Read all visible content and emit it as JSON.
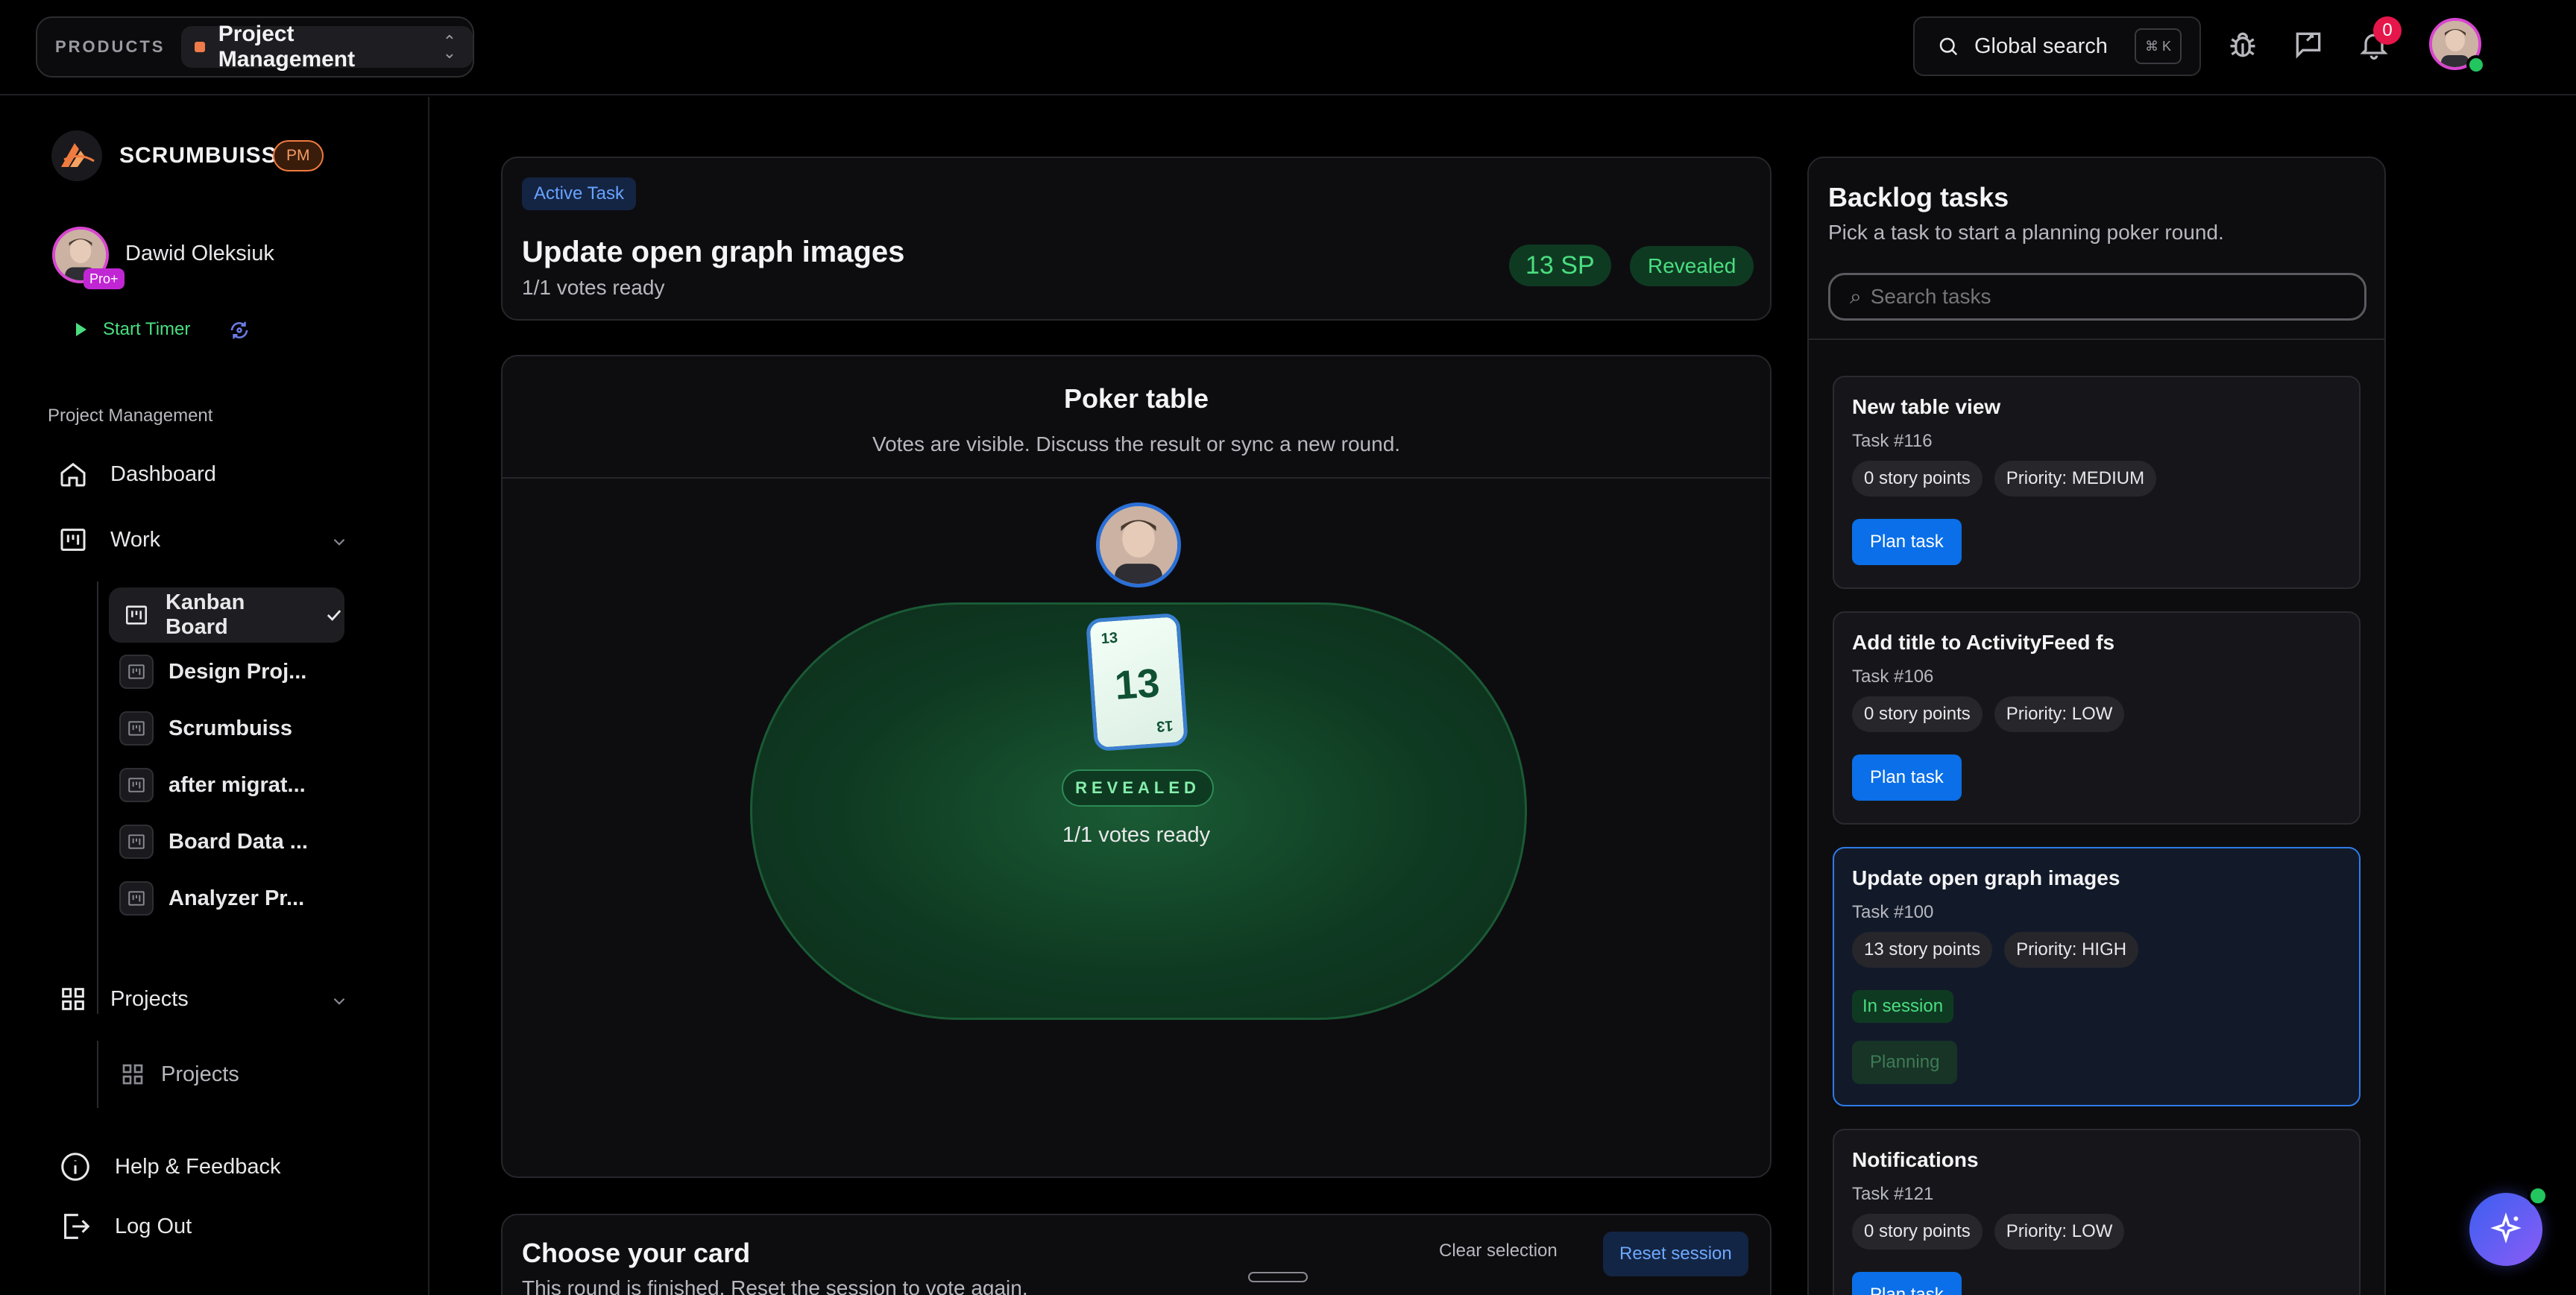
{
  "topbar": {
    "products_label": "PRODUCTS",
    "product_name": "Project Management",
    "search_label": "Global search",
    "search_kbd": "⌘ K",
    "notification_count": "0"
  },
  "sidebar": {
    "brand": "SCRUMBUISS",
    "brand_badge": "PM",
    "user_name": "Dawid Oleksiuk",
    "user_badge": "Pro+",
    "start_timer": "Start Timer",
    "section_label": "Project Management",
    "dashboard": "Dashboard",
    "work": "Work",
    "work_items": [
      {
        "label": "Kanban Board"
      },
      {
        "label": "Design Proj..."
      },
      {
        "label": "Scrumbuiss"
      },
      {
        "label": "after migrat..."
      },
      {
        "label": "Board Data ..."
      },
      {
        "label": "Analyzer Pr..."
      }
    ],
    "projects": "Projects",
    "projects_items": [
      {
        "label": "Projects"
      }
    ],
    "help": "Help & Feedback",
    "logout": "Log Out"
  },
  "active_task": {
    "chip": "Active Task",
    "title": "Update open graph images",
    "votes": "1/1 votes ready",
    "sp": "13 SP",
    "status": "Revealed"
  },
  "poker": {
    "title": "Poker table",
    "subtitle": "Votes are visible. Discuss the result or sync a new round.",
    "card_value": "13",
    "revealed_label": "REVEALED",
    "votes_ready": "1/1 votes ready"
  },
  "choose": {
    "title": "Choose your card",
    "subtitle": "This round is finished. Reset the session to vote again.",
    "clear": "Clear selection",
    "reset": "Reset session"
  },
  "backlog": {
    "title": "Backlog tasks",
    "subtitle": "Pick a task to start a planning poker round.",
    "search_placeholder": "Search tasks",
    "tasks": [
      {
        "title": "New table view",
        "id": "Task #116",
        "points": "0 story points",
        "priority": "Priority: MEDIUM",
        "action": "Plan task"
      },
      {
        "title": "Add title to ActivityFeed fs",
        "id": "Task #106",
        "points": "0 story points",
        "priority": "Priority: LOW",
        "action": "Plan task"
      },
      {
        "title": "Update open graph images",
        "id": "Task #100",
        "points": "13 story points",
        "priority": "Priority: HIGH",
        "status": "In session",
        "action": "Planning"
      },
      {
        "title": "Notifications",
        "id": "Task #121",
        "points": "0 story points",
        "priority": "Priority: LOW",
        "action": "Plan task"
      }
    ]
  },
  "colors": {
    "accent": "#0a6fe8",
    "success": "#4ade80",
    "brand": "#f07b3f",
    "table_green": "#0f3a22"
  }
}
